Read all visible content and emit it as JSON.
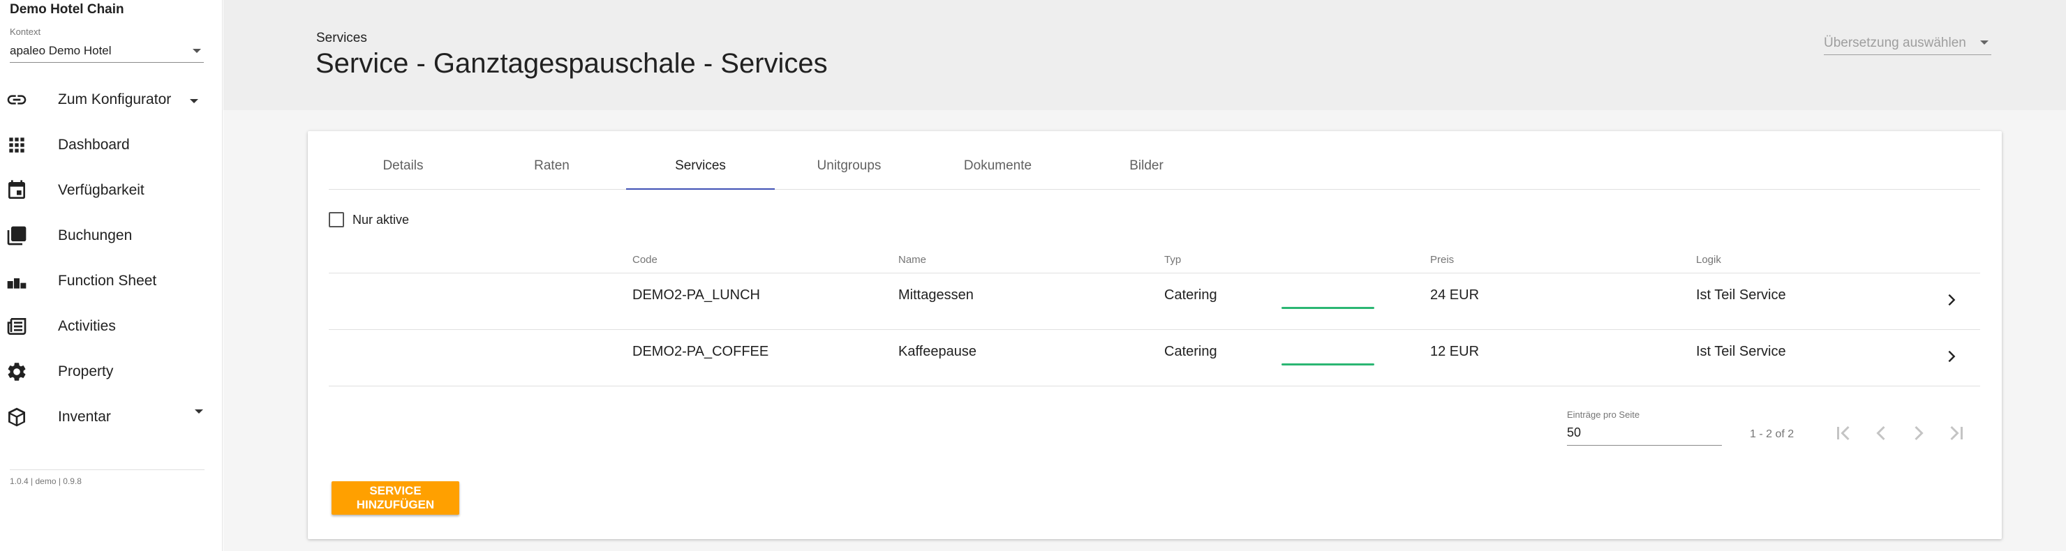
{
  "sidebar": {
    "brand": "Demo Hotel Chain",
    "context_label": "Kontext",
    "context_value": "apaleo Demo Hotel",
    "items": [
      {
        "label": "Zum Konfigurator",
        "icon": "link-icon"
      },
      {
        "label": "Dashboard",
        "icon": "apps-grid-icon"
      },
      {
        "label": "Verfügbarkeit",
        "icon": "calendar-icon"
      },
      {
        "label": "Buchungen",
        "icon": "copy-stack-icon"
      },
      {
        "label": "Function Sheet",
        "icon": "bar-chart-icon"
      },
      {
        "label": "Activities",
        "icon": "newspaper-icon"
      },
      {
        "label": "Property",
        "icon": "gear-icon"
      },
      {
        "label": "Inventar",
        "icon": "cube-icon"
      }
    ],
    "version": "1.0.4 | demo | 0.9.8"
  },
  "header": {
    "breadcrumb": "Services",
    "title": "Service - Ganztagespauschale - Services",
    "language_placeholder": "Übersetzung auswählen"
  },
  "tabs": [
    {
      "label": "Details"
    },
    {
      "label": "Raten"
    },
    {
      "label": "Services"
    },
    {
      "label": "Unitgroups"
    },
    {
      "label": "Dokumente"
    },
    {
      "label": "Bilder"
    }
  ],
  "active_tab": "Services",
  "filter": {
    "label": "Nur aktive",
    "checked": false
  },
  "table": {
    "columns": [
      "Code",
      "Name",
      "Typ",
      "Preis",
      "Logik"
    ],
    "rows": [
      {
        "code": "DEMO2-PA_LUNCH",
        "name": "Mittagessen",
        "type": "Catering",
        "price": "24 EUR",
        "logic": "Ist Teil Service"
      },
      {
        "code": "DEMO2-PA_COFFEE",
        "name": "Kaffeepause",
        "type": "Catering",
        "price": "12 EUR",
        "logic": "Ist Teil Service"
      }
    ]
  },
  "pagination": {
    "per_page_label": "Einträge pro Seite",
    "per_page_value": "50",
    "range": "1 - 2 of 2"
  },
  "add_button": "SERVICE HINZUFÜGEN",
  "colors": {
    "accent": "#ffa000",
    "tab_indicator": "#3f51b5",
    "price_underline": "#2bb673"
  }
}
